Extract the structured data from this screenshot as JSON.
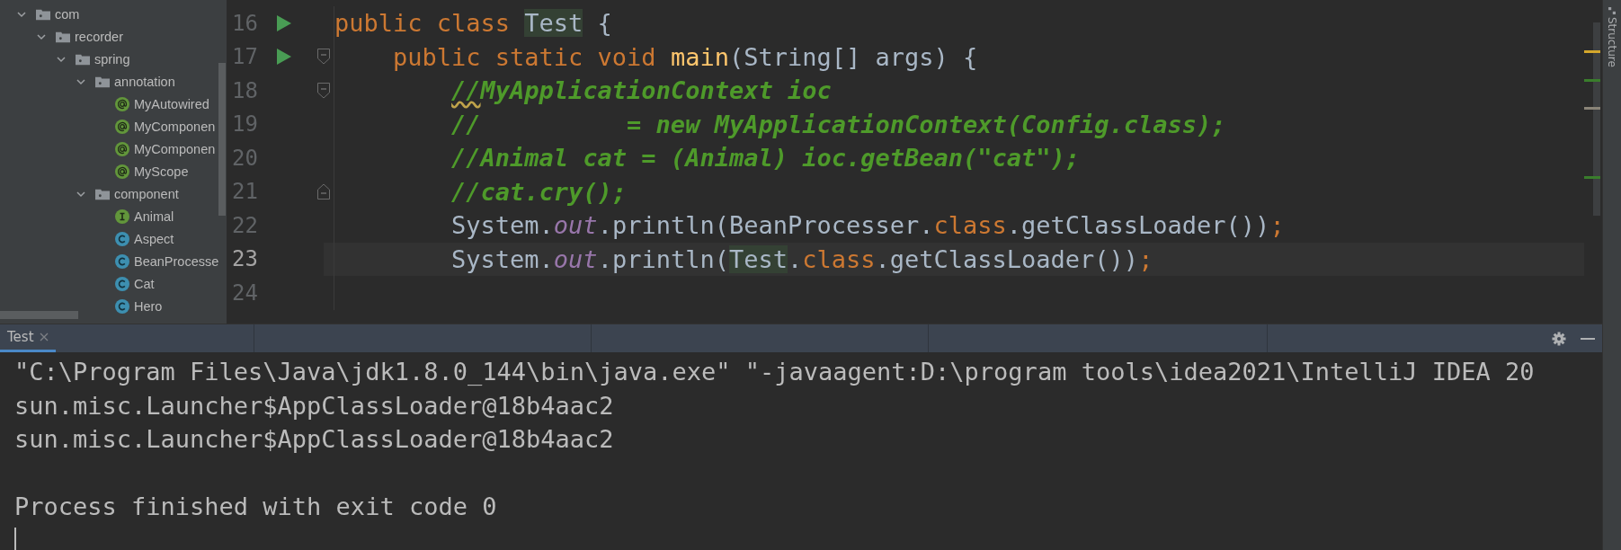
{
  "project_tree": [
    {
      "label": "com",
      "kind": "package",
      "expanded": true,
      "children": [
        {
          "label": "recorder",
          "kind": "package",
          "expanded": true,
          "children": [
            {
              "label": "spring",
              "kind": "package",
              "expanded": true,
              "children": [
                {
                  "label": "annotation",
                  "kind": "package",
                  "expanded": true,
                  "children": [
                    {
                      "label": "MyAutowired",
                      "kind": "annotation"
                    },
                    {
                      "label": "MyComponen",
                      "kind": "annotation"
                    },
                    {
                      "label": "MyComponen",
                      "kind": "annotation"
                    },
                    {
                      "label": "MyScope",
                      "kind": "annotation"
                    }
                  ]
                },
                {
                  "label": "component",
                  "kind": "package",
                  "expanded": true,
                  "children": [
                    {
                      "label": "Animal",
                      "kind": "interface"
                    },
                    {
                      "label": "Aspect",
                      "kind": "class"
                    },
                    {
                      "label": "BeanProcesse",
                      "kind": "class"
                    },
                    {
                      "label": "Cat",
                      "kind": "class"
                    },
                    {
                      "label": "Hero",
                      "kind": "class"
                    }
                  ]
                }
              ]
            }
          ]
        }
      ]
    }
  ],
  "editor": {
    "lines": [
      {
        "number": "16",
        "run": true,
        "current": false,
        "tokens": [
          {
            "kind": "keyword",
            "text": "public class "
          },
          {
            "kind": "usage",
            "text": "Test"
          },
          {
            "kind": "plain",
            "text": " {"
          }
        ]
      },
      {
        "number": "17",
        "run": true,
        "fold_open": true,
        "current": false,
        "tokens": [
          {
            "kind": "keyword",
            "text": "    public static void "
          },
          {
            "kind": "method",
            "text": "main"
          },
          {
            "kind": "plain",
            "text": "(String[] args) {"
          }
        ]
      },
      {
        "number": "18",
        "fold_open": true,
        "current": false,
        "tokens": [
          {
            "kind": "comment-warning",
            "text": "        //"
          },
          {
            "kind": "comment",
            "text": "MyApplicationContext ioc"
          }
        ]
      },
      {
        "number": "19",
        "current": false,
        "tokens": [
          {
            "kind": "comment",
            "text": "        //          = new MyApplicationContext(Config.class);"
          }
        ]
      },
      {
        "number": "20",
        "current": false,
        "tokens": [
          {
            "kind": "comment",
            "text": "        //Animal cat = (Animal) ioc.getBean(\"cat\");"
          }
        ]
      },
      {
        "number": "21",
        "fold_close": true,
        "current": false,
        "tokens": [
          {
            "kind": "comment",
            "text": "        //cat.cry();"
          }
        ]
      },
      {
        "number": "22",
        "current": false,
        "tokens": [
          {
            "kind": "plain",
            "text": "        System."
          },
          {
            "kind": "field",
            "text": "out"
          },
          {
            "kind": "plain",
            "text": ".println(BeanProcesser."
          },
          {
            "kind": "keyword",
            "text": "class"
          },
          {
            "kind": "plain",
            "text": ".getClassLoader())"
          },
          {
            "kind": "keyword",
            "text": ";"
          }
        ]
      },
      {
        "number": "23",
        "current": true,
        "tokens": [
          {
            "kind": "plain",
            "text": "        System."
          },
          {
            "kind": "field",
            "text": "out"
          },
          {
            "kind": "plain",
            "text": ".println("
          },
          {
            "kind": "usage",
            "text": "Test"
          },
          {
            "kind": "plain",
            "text": "."
          },
          {
            "kind": "keyword",
            "text": "class"
          },
          {
            "kind": "plain",
            "text": ".getClassLoader())"
          },
          {
            "kind": "keyword",
            "text": ";"
          }
        ]
      },
      {
        "number": "24",
        "current": false
      }
    ]
  },
  "side_tab": {
    "label": "Structure"
  },
  "run_panel": {
    "tabs": [
      {
        "label": "Test",
        "selected": true
      }
    ],
    "output": [
      {
        "text": "\"C:\\Program Files\\Java\\jdk1.8.0_144\\bin\\java.exe\" \"-javaagent:D:\\program tools\\idea2021\\IntelliJ IDEA 20",
        "blank_before": false
      },
      {
        "text": "sun.misc.Launcher$AppClassLoader@18b4aac2",
        "blank_before": false
      },
      {
        "text": "sun.misc.Launcher$AppClassLoader@18b4aac2",
        "blank_before": false
      },
      {
        "text": "Process finished with exit code 0",
        "blank_before": true
      }
    ]
  }
}
